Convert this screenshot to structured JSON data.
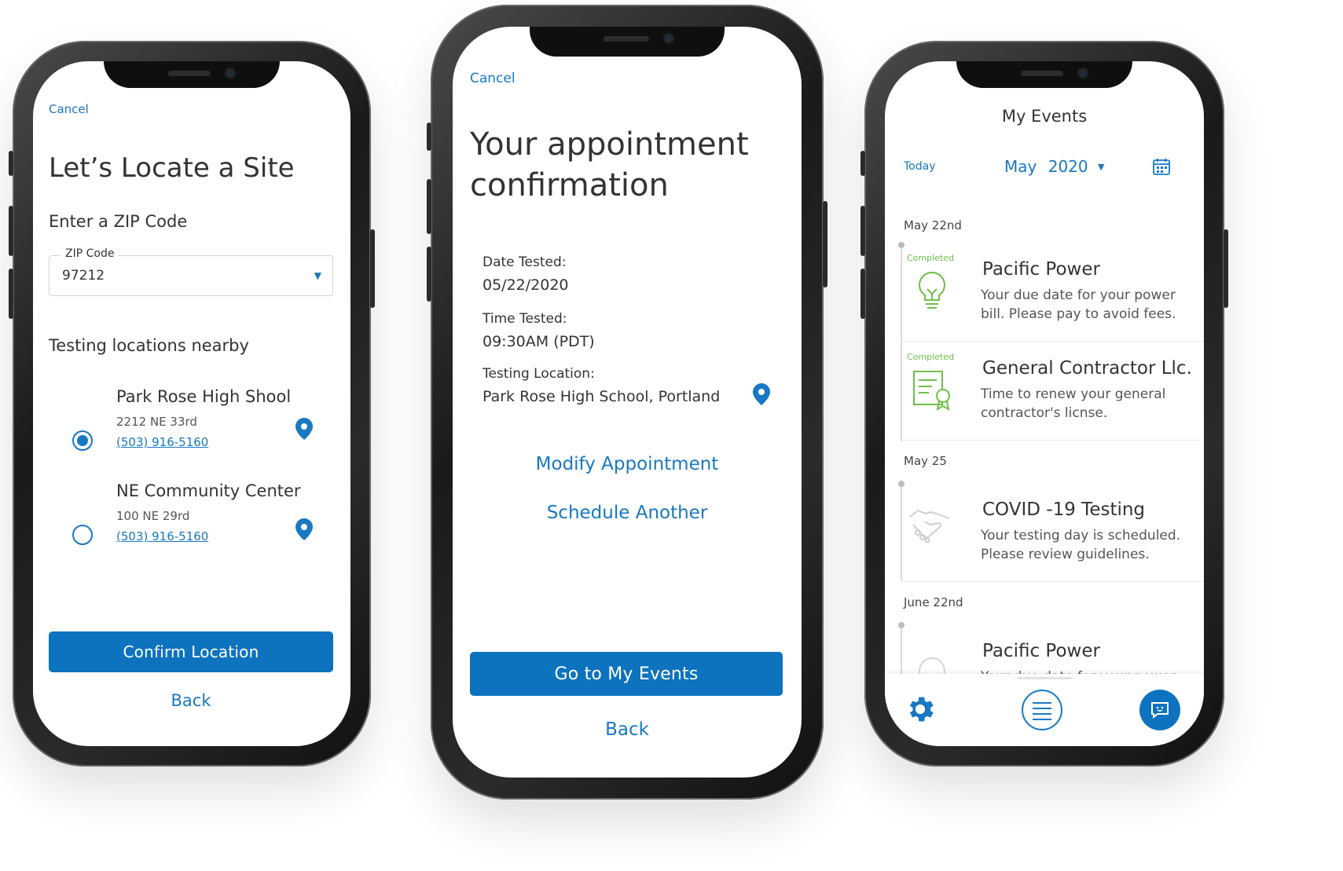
{
  "left": {
    "cancel": "Cancel",
    "title": "Let’s Locate a Site",
    "subtitle": "Enter a ZIP Code",
    "zip_label": "ZIP Code",
    "zip_value": "97212",
    "nearby_heading": "Testing locations nearby",
    "locations": [
      {
        "name": "Park Rose High Shool",
        "address": "2212 NE 33rd",
        "phone": "(503) 916-5160",
        "selected": true
      },
      {
        "name": "NE Community Center",
        "address": "100 NE 29rd",
        "phone": "(503) 916-5160",
        "selected": false
      }
    ],
    "confirm": "Confirm Location",
    "back": "Back"
  },
  "middle": {
    "cancel": "Cancel",
    "title_line1": "Your appointment",
    "title_line2": "confirmation",
    "date_label": "Date Tested:",
    "date_value": "05/22/2020",
    "time_label": "Time Tested:",
    "time_value": "09:30AM (PDT)",
    "loc_label": "Testing Location:",
    "loc_value": "Park Rose High School, Portland",
    "modify": "Modify Appointment",
    "schedule": "Schedule Another",
    "go_events": "Go to My Events",
    "back": "Back"
  },
  "right": {
    "title": "My Events",
    "today": "Today",
    "month": "May",
    "year": "2020",
    "groups": [
      {
        "date": "May 22nd"
      },
      {
        "date": "May 25"
      },
      {
        "date": "June 22nd"
      }
    ],
    "events": [
      {
        "status": "Completed",
        "title": "Pacific Power",
        "desc1": "Your due date for your power",
        "desc2": "bill. Please pay to avoid fees.",
        "icon": "lightbulb-icon"
      },
      {
        "status": "Completed",
        "title": "General Contractor Llc.",
        "desc1": "Time to renew your general",
        "desc2": "contractor's licnse.",
        "icon": "certificate-icon"
      },
      {
        "status": "",
        "title": "COVID -19 Testing",
        "desc1": "Your testing day is scheduled.",
        "desc2": "Please review guidelines.",
        "icon": "handshake-icon"
      },
      {
        "status": "",
        "title": "Pacific Power",
        "desc1": "Your due date for your power",
        "desc2": "",
        "icon": "lightbulb-icon"
      }
    ]
  },
  "colors": {
    "accent": "#0d73bf",
    "link": "#1878c2",
    "completed": "#6fbf4a"
  }
}
